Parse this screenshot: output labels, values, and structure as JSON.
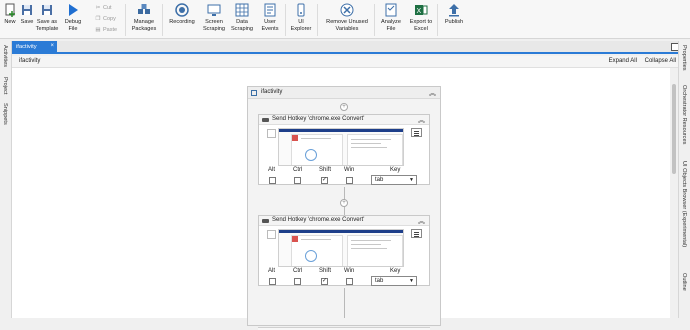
{
  "ribbon": {
    "new": "New",
    "save": "Save",
    "save_template": "Save as Template",
    "debug": "Debug File",
    "cut": "Cut",
    "copy": "Copy",
    "paste": "Paste",
    "manage_packages": "Manage Packages",
    "recording": "Recording",
    "screen_scraping": "Screen Scraping",
    "data_scraping": "Data Scraping",
    "user_events": "User Events",
    "ui_explorer": "UI Explorer",
    "remove_unused": "Remove Unused Variables",
    "analyze": "Analyze File",
    "export_excel": "Export to Excel",
    "publish": "Publish"
  },
  "tab": {
    "label": "ifactivity"
  },
  "left_rail": [
    "Activities",
    "Project",
    "Snippets"
  ],
  "right_rail": [
    "Properties",
    "Orchestrator Resources",
    "UI Objects Browser (Experimental)",
    "Outline"
  ],
  "designer": {
    "breadcrumb": "ifactivity",
    "expand_all": "Expand All",
    "collapse_all": "Collapse All",
    "sequence_title": "ifactivity"
  },
  "activities": [
    {
      "title": "Send Hotkey 'chrome.exe Convert'",
      "modifiers": [
        "Alt",
        "Ctrl",
        "Shift",
        "Win"
      ],
      "checked": [
        false,
        false,
        true,
        false
      ],
      "key_label": "Key",
      "key_value": "tab"
    },
    {
      "title": "Send Hotkey 'chrome.exe Convert'",
      "modifiers": [
        "Alt",
        "Ctrl",
        "Shift",
        "Win"
      ],
      "checked": [
        false,
        false,
        true,
        false
      ],
      "key_label": "Key",
      "key_value": "tab"
    }
  ],
  "colors": {
    "accent": "#2b7bd6",
    "banner": "#1e3f8a"
  }
}
